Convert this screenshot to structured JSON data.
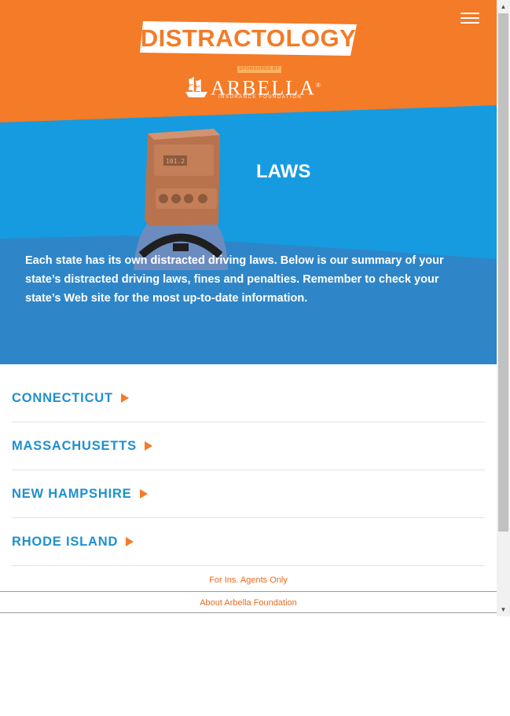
{
  "header": {
    "logo_text": "DISTRACTOLOGY",
    "sponsored_text": "SPONSORED BY",
    "sponsor_name": "ARBELLA",
    "sponsor_trademark": "®",
    "sponsor_subtitle": "INSURANCE FOUNDATION",
    "menu_icon": "hamburger-menu-icon"
  },
  "hero": {
    "title": "LAWS",
    "intro": "Each state has its own distracted driving laws. Below is our summary of your state’s distracted driving laws, fines and penalties. Remember to check your state’s Web site for the most up-to-date information.",
    "radio_display": "101.2"
  },
  "states": [
    {
      "label": "CONNECTICUT"
    },
    {
      "label": "MASSACHUSETTS"
    },
    {
      "label": "NEW HAMPSHIRE"
    },
    {
      "label": "RHODE ISLAND"
    }
  ],
  "footer": {
    "agents_link": "For Ins. Agents Only",
    "about_link": "About Arbella Foundation"
  },
  "colors": {
    "brand_orange": "#f47b27",
    "hero_blue": "#1a8fd6",
    "link_blue": "#1e90cf",
    "link_orange": "#e86a1f"
  }
}
